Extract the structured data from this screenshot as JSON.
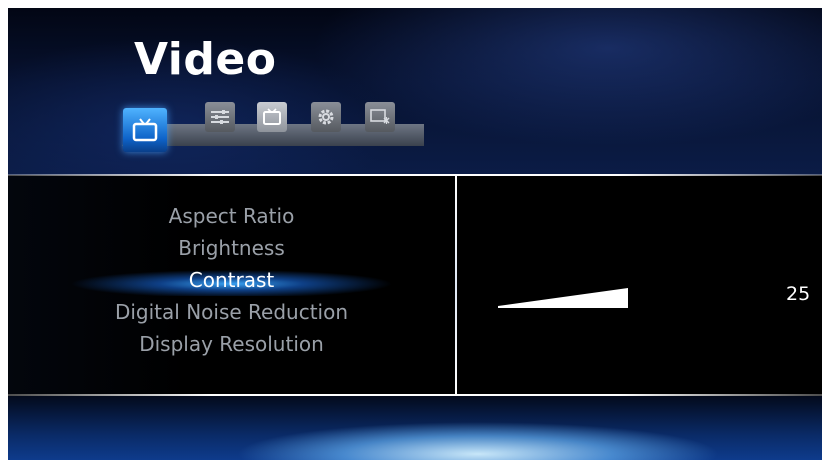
{
  "header": {
    "title": "Video",
    "tabs": [
      {
        "icon": "tv-icon",
        "active": true
      },
      {
        "icon": "sliders-icon",
        "active": false
      },
      {
        "icon": "tv-outline-icon",
        "active": false
      },
      {
        "icon": "gear-icon",
        "active": false
      },
      {
        "icon": "display-settings-icon",
        "active": false
      }
    ]
  },
  "menu": {
    "items": [
      "Aspect Ratio",
      "Brightness",
      "Contrast",
      "Digital Noise Reduction",
      "Display Resolution"
    ],
    "selected": "Contrast"
  },
  "setting": {
    "name": "Contrast",
    "value": "25",
    "level": 25
  },
  "colors": {
    "accent": "#2f8ef0",
    "text_selected": "#ffffff",
    "text_unselected": "#9aa0a8"
  }
}
